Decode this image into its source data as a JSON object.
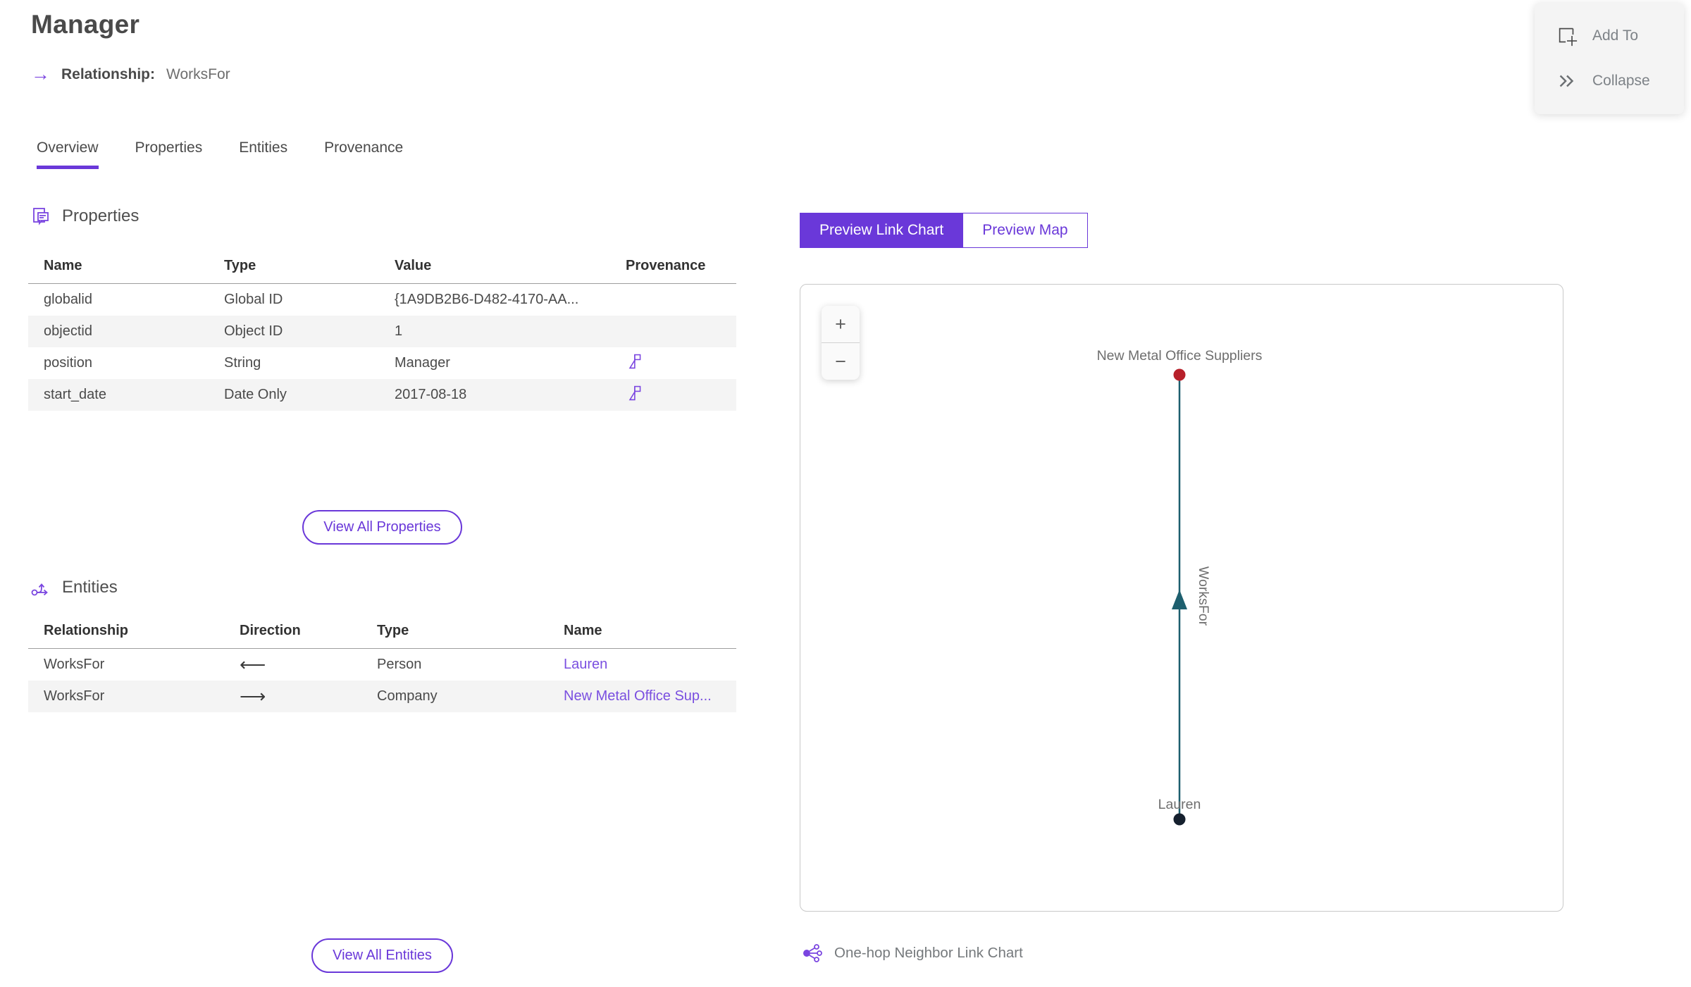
{
  "header": {
    "title": "Manager",
    "relationship_arrow_glyph": "→",
    "relationship_label": "Relationship:",
    "relationship_value": "WorksFor"
  },
  "actions": {
    "add_to_label": "Add To",
    "collapse_glyph": "»",
    "collapse_label": "Collapse"
  },
  "tabs": [
    {
      "label": "Overview",
      "active": true
    },
    {
      "label": "Properties",
      "active": false
    },
    {
      "label": "Entities",
      "active": false
    },
    {
      "label": "Provenance",
      "active": false
    }
  ],
  "properties_section": {
    "title": "Properties",
    "columns": [
      "Name",
      "Type",
      "Value",
      "Provenance"
    ],
    "rows": [
      {
        "name": "globalid",
        "type": "Global ID",
        "value": "{1A9DB2B6-D482-4170-AA...",
        "has_provenance": false
      },
      {
        "name": "objectid",
        "type": "Object ID",
        "value": "1",
        "has_provenance": false
      },
      {
        "name": "position",
        "type": "String",
        "value": "Manager",
        "has_provenance": true
      },
      {
        "name": "start_date",
        "type": "Date Only",
        "value": "2017-08-18",
        "has_provenance": true
      }
    ],
    "view_all_label": "View All Properties"
  },
  "entities_section": {
    "title": "Entities",
    "columns": [
      "Relationship",
      "Direction",
      "Type",
      "Name"
    ],
    "rows": [
      {
        "relationship": "WorksFor",
        "direction_glyph": "⟵",
        "type": "Person",
        "name": "Lauren"
      },
      {
        "relationship": "WorksFor",
        "direction_glyph": "⟶",
        "type": "Company",
        "name": "New Metal Office Sup..."
      }
    ],
    "view_all_label": "View All Entities"
  },
  "preview": {
    "toggle": [
      {
        "label": "Preview Link Chart",
        "selected": true
      },
      {
        "label": "Preview Map",
        "selected": false
      }
    ],
    "zoom_in_glyph": "+",
    "zoom_out_glyph": "−",
    "footer_label": "One-hop Neighbor Link Chart",
    "graph": {
      "nodes": [
        {
          "label": "New Metal Office Suppliers",
          "color": "#b7202a"
        },
        {
          "label": "Lauren",
          "color": "#15202e"
        }
      ],
      "edge": {
        "label": "WorksFor",
        "color": "#1d5f6e"
      }
    }
  },
  "colors": {
    "accent": "#6a38d9",
    "link": "#7a4fe0",
    "icon_purple": "#7a45e0",
    "edge_teal": "#1d5f6e",
    "node_red": "#b7202a",
    "node_dark": "#15202e",
    "alt_row": "#f4f4f4"
  }
}
